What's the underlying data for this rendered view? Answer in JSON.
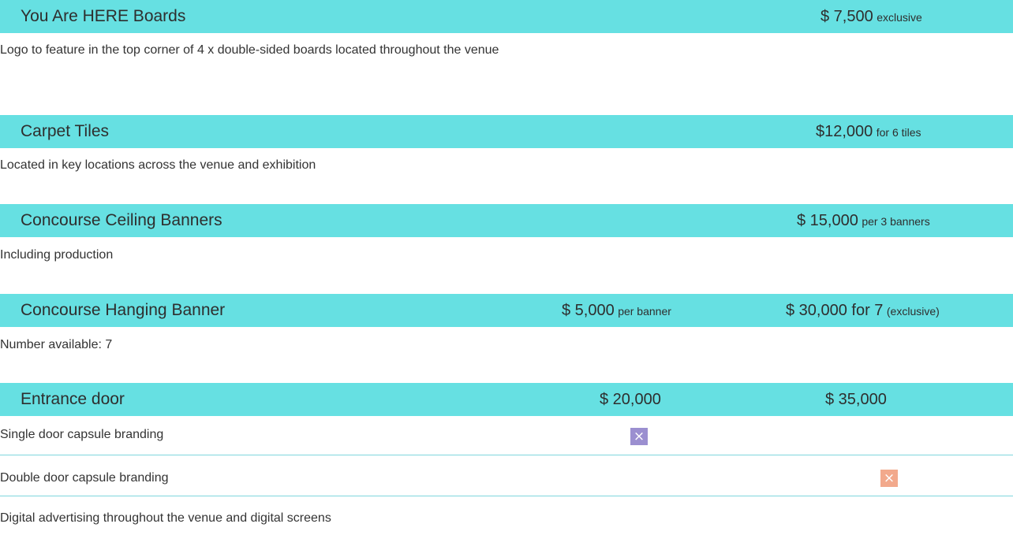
{
  "sections": [
    {
      "title": "You Are HERE Boards",
      "price": {
        "amount": "$ 7,500",
        "qualifier": "exclusive"
      },
      "description": "Logo to feature in the top corner of 4 x double-sided boards located throughout the venue"
    },
    {
      "title": "Carpet Tiles",
      "price": {
        "amount": "$12,000",
        "qualifier": "for 6 tiles"
      },
      "description": "Located in key locations across the venue and exhibition"
    },
    {
      "title": "Concourse Ceiling Banners",
      "price": {
        "amount": "$ 15,000",
        "qualifier": "per 3 banners"
      },
      "description": "Including production"
    },
    {
      "title": "Concourse Hanging Banner",
      "price_a": {
        "amount": "$ 5,000",
        "qualifier": "per banner"
      },
      "price_b": {
        "amount": "$ 30,000 for 7",
        "qualifier": "(exclusive)"
      },
      "description": "Number available: 7"
    },
    {
      "title": "Entrance door",
      "price_a": {
        "amount": "$ 20,000"
      },
      "price_b": {
        "amount": "$ 35,000"
      },
      "rows": [
        {
          "label": "Single door capsule branding",
          "mark": "×",
          "mark_color": "#9b8fd0"
        },
        {
          "label": "Double door capsule branding",
          "mark": "×",
          "mark_color": "#f2a98c"
        },
        {
          "label": "Digital advertising throughout the venue and digital screens"
        }
      ]
    }
  ],
  "colors": {
    "header_bar": "#66e0e2",
    "row_rule": "#7ed6dc",
    "text": "#333333"
  }
}
